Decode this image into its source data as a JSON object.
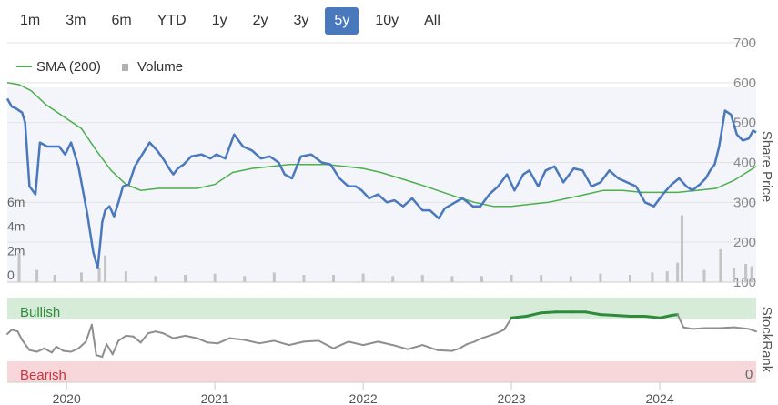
{
  "range_buttons": [
    "1m",
    "3m",
    "6m",
    "YTD",
    "1y",
    "2y",
    "3y",
    "5y",
    "10y",
    "All"
  ],
  "active_range": "5y",
  "legend": {
    "sma_label": "SMA (200)",
    "volume_label": "Volume"
  },
  "colors": {
    "price": "#4a78bd",
    "sma": "#4cae4c",
    "volume": "#c4c4c4",
    "bullish_band": "#d6ecd8",
    "bearish_band": "#f7d7d9",
    "stockrank_bull": "#2e8b3c",
    "stockrank_neutral": "#8e8e8e"
  },
  "chart_data": [
    {
      "type": "line",
      "ylabel": "Share Price",
      "ylim": [
        100,
        700
      ],
      "yticks": [
        "700",
        "600",
        "500",
        "400",
        "300",
        "200",
        "100"
      ],
      "vol_ticks": [
        "6m",
        "4m",
        "2m",
        "0"
      ],
      "vol_ylim": [
        0,
        9
      ],
      "xlabels": [
        "2020",
        "2021",
        "2022",
        "2023",
        "2024"
      ],
      "xlim": [
        2019.6,
        2024.65
      ],
      "series": [
        {
          "name": "",
          "x": [
            2019.6,
            2019.63,
            2019.66,
            2019.7,
            2019.72,
            2019.75,
            2019.79,
            2019.82,
            2019.87,
            2019.92,
            2019.95,
            2019.99,
            2020.03,
            2020.08,
            2020.11,
            2020.14,
            2020.18,
            2020.21,
            2020.23,
            2020.24,
            2020.26,
            2020.29,
            2020.32,
            2020.35,
            2020.38,
            2020.42,
            2020.46,
            2020.51,
            2020.56,
            2020.61,
            2020.65,
            2020.7,
            2020.72,
            2020.75,
            2020.79,
            2020.84,
            2020.91,
            2020.97,
            2021.01,
            2021.07,
            2021.13,
            2021.19,
            2021.25,
            2021.31,
            2021.37,
            2021.43,
            2021.47,
            2021.52,
            2021.58,
            2021.65,
            2021.72,
            2021.78,
            2021.84,
            2021.9,
            2021.95,
            2021.99,
            2022.04,
            2022.1,
            2022.16,
            2022.21,
            2022.27,
            2022.33,
            2022.4,
            2022.45,
            2022.51,
            2022.55,
            2022.62,
            2022.67,
            2022.74,
            2022.79,
            2022.85,
            2022.91,
            2022.97,
            2023.02,
            2023.08,
            2023.12,
            2023.18,
            2023.23,
            2023.29,
            2023.35,
            2023.42,
            2023.48,
            2023.54,
            2023.6,
            2023.66,
            2023.72,
            2023.78,
            2023.84,
            2023.9,
            2023.96,
            2024.02,
            2024.08,
            2024.13,
            2024.18,
            2024.22,
            2024.27,
            2024.31,
            2024.34,
            2024.37,
            2024.4,
            2024.44,
            2024.48,
            2024.52,
            2024.56,
            2024.6,
            2024.63,
            2024.65
          ],
          "values": [
            560,
            540,
            535,
            525,
            500,
            340,
            320,
            450,
            440,
            440,
            440,
            420,
            450,
            390,
            330,
            270,
            175,
            135,
            210,
            250,
            280,
            290,
            265,
            300,
            340,
            345,
            390,
            420,
            450,
            430,
            410,
            380,
            370,
            385,
            395,
            415,
            420,
            410,
            420,
            410,
            470,
            440,
            430,
            410,
            415,
            400,
            370,
            360,
            415,
            420,
            400,
            395,
            360,
            340,
            340,
            330,
            310,
            320,
            300,
            305,
            290,
            310,
            280,
            280,
            260,
            285,
            300,
            310,
            290,
            290,
            320,
            340,
            370,
            330,
            370,
            380,
            340,
            380,
            390,
            350,
            385,
            380,
            340,
            350,
            380,
            360,
            350,
            340,
            300,
            290,
            320,
            345,
            360,
            340,
            330,
            345,
            360,
            380,
            395,
            440,
            530,
            520,
            470,
            455,
            460,
            480,
            475
          ]
        },
        {
          "name": "SMA (200)",
          "x": [
            2019.6,
            2019.68,
            2019.76,
            2019.86,
            2019.98,
            2020.1,
            2020.2,
            2020.3,
            2020.4,
            2020.5,
            2020.62,
            2020.75,
            2020.88,
            2021.0,
            2021.12,
            2021.25,
            2021.38,
            2021.5,
            2021.62,
            2021.75,
            2021.88,
            2022.0,
            2022.12,
            2022.25,
            2022.38,
            2022.5,
            2022.62,
            2022.75,
            2022.88,
            2023.0,
            2023.12,
            2023.25,
            2023.38,
            2023.5,
            2023.62,
            2023.75,
            2023.88,
            2024.0,
            2024.12,
            2024.25,
            2024.38,
            2024.5,
            2024.65
          ],
          "values": [
            600,
            595,
            580,
            545,
            515,
            485,
            430,
            380,
            345,
            330,
            335,
            335,
            335,
            345,
            375,
            385,
            390,
            395,
            395,
            395,
            390,
            385,
            375,
            360,
            345,
            330,
            315,
            300,
            290,
            290,
            295,
            300,
            310,
            320,
            330,
            330,
            325,
            325,
            325,
            330,
            335,
            355,
            390
          ]
        },
        {
          "name": "Volume",
          "x": [
            2019.68,
            2019.8,
            2019.92,
            2020.1,
            2020.22,
            2020.26,
            2020.4,
            2020.6,
            2020.8,
            2021.0,
            2021.2,
            2021.4,
            2021.6,
            2021.8,
            2022.0,
            2022.2,
            2022.4,
            2022.6,
            2022.8,
            2023.0,
            2023.2,
            2023.4,
            2023.6,
            2023.8,
            2023.95,
            2024.05,
            2024.12,
            2024.15,
            2024.3,
            2024.41,
            2024.5,
            2024.58,
            2024.62
          ],
          "values": [
            2.4,
            1.0,
            0.6,
            0.8,
            1.2,
            2.2,
            0.9,
            0.5,
            0.6,
            0.7,
            0.5,
            0.8,
            0.6,
            0.6,
            0.7,
            0.5,
            0.6,
            0.5,
            0.5,
            0.6,
            0.6,
            0.5,
            0.7,
            0.6,
            0.8,
            0.9,
            1.6,
            5.5,
            1.0,
            2.7,
            1.2,
            1.5,
            1.3
          ]
        }
      ]
    },
    {
      "type": "line",
      "ylabel": "StockRank",
      "ylim": [
        0,
        100
      ],
      "yticks": [
        "0"
      ],
      "bands": [
        "Bullish",
        "Bearish"
      ],
      "series": [
        {
          "name": "StockRank",
          "x": [
            2019.6,
            2019.63,
            2019.67,
            2019.7,
            2019.75,
            2019.8,
            2019.85,
            2019.9,
            2019.93,
            2019.98,
            2020.03,
            2020.08,
            2020.13,
            2020.17,
            2020.2,
            2020.24,
            2020.27,
            2020.31,
            2020.35,
            2020.4,
            2020.45,
            2020.5,
            2020.55,
            2020.6,
            2020.65,
            2020.72,
            2020.8,
            2020.88,
            2020.95,
            2021.02,
            2021.1,
            2021.2,
            2021.3,
            2021.4,
            2021.5,
            2021.6,
            2021.7,
            2021.8,
            2021.9,
            2022.0,
            2022.1,
            2022.2,
            2022.3,
            2022.4,
            2022.5,
            2022.6,
            2022.65,
            2022.7,
            2022.75,
            2022.8,
            2022.85,
            2022.9,
            2022.95,
            2023.0,
            2023.1,
            2023.2,
            2023.3,
            2023.4,
            2023.5,
            2023.6,
            2023.7,
            2023.8,
            2023.9,
            2024.0,
            2024.08,
            2024.12,
            2024.16,
            2024.22,
            2024.3,
            2024.4,
            2024.5,
            2024.6,
            2024.65
          ],
          "values": [
            57,
            62,
            60,
            50,
            38,
            36,
            40,
            35,
            42,
            37,
            36,
            40,
            48,
            68,
            32,
            30,
            45,
            33,
            49,
            55,
            54,
            47,
            58,
            60,
            58,
            52,
            55,
            52,
            47,
            46,
            52,
            50,
            46,
            49,
            44,
            48,
            49,
            40,
            48,
            44,
            48,
            44,
            39,
            44,
            38,
            37,
            40,
            45,
            48,
            52,
            55,
            58,
            62,
            76,
            78,
            82,
            83,
            83,
            83,
            80,
            79,
            78,
            78,
            76,
            79,
            80,
            65,
            63,
            64,
            64,
            65,
            63,
            60
          ]
        }
      ]
    }
  ]
}
